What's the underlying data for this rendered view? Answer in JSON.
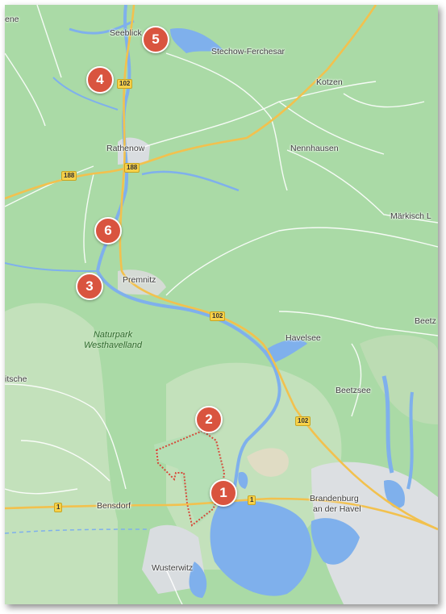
{
  "colors": {
    "land_dark": "#a8d5a2",
    "land_light": "#c6e2bd",
    "water": "#7fb0ec",
    "urban": "#dcdfe2",
    "road_major": "#f2c14e",
    "marker": "#d9543f",
    "boundary": "#d64a3a"
  },
  "places": {
    "seeblick": "Seeblick",
    "stechow": "Stechow-Ferchesar",
    "kotzen": "Kotzen",
    "rathenow": "Rathenow",
    "nennhausen": "Nennhausen",
    "maerkisch": "Märkisch L",
    "premnitz": "Premnitz",
    "havelsee": "Havelsee",
    "beetz_edge": "Beetz",
    "beetzsee": "Beetzsee",
    "itsche": "itsche",
    "ene": "ene",
    "bensdorf": "Bensdorf",
    "brandenburg": "Brandenburg",
    "an_der_havel": "an der Havel",
    "wusterwitz": "Wusterwitz"
  },
  "park": {
    "line1": "Naturpark",
    "line2": "Westhavelland"
  },
  "roads": {
    "b102_a": "102",
    "b102_b": "102",
    "b102_c": "102",
    "b188_a": "188",
    "b188_b": "188",
    "b1_a": "1",
    "b1_b": "1"
  },
  "markers": [
    {
      "label": "1",
      "icon": "map-pin"
    },
    {
      "label": "2",
      "icon": "map-pin"
    },
    {
      "label": "3",
      "icon": "map-pin"
    },
    {
      "label": "4",
      "icon": "map-pin"
    },
    {
      "label": "5",
      "icon": "map-pin"
    },
    {
      "label": "6",
      "icon": "map-pin"
    }
  ]
}
